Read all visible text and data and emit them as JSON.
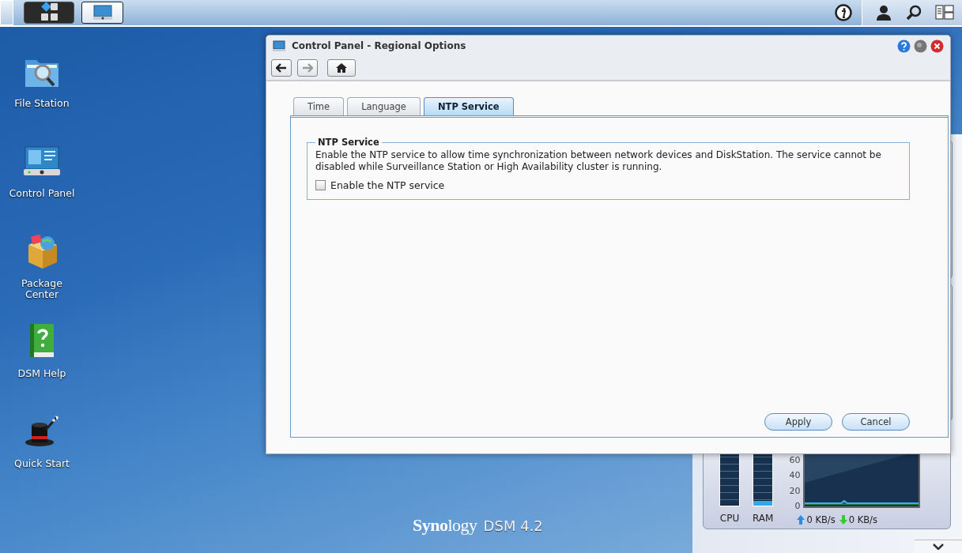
{
  "desktop_icons": [
    {
      "kind": "file-station",
      "label": "File Station"
    },
    {
      "kind": "control-panel",
      "label": "Control Panel"
    },
    {
      "kind": "package-center",
      "label": "Package Center"
    },
    {
      "kind": "help",
      "label": "DSM Help"
    },
    {
      "kind": "quick-start",
      "label": "Quick Start"
    }
  ],
  "window": {
    "title": "Control Panel - Regional Options",
    "tabs": [
      {
        "label": "Time",
        "selected": false
      },
      {
        "label": "Language",
        "selected": false
      },
      {
        "label": "NTP Service",
        "selected": true
      }
    ],
    "section": {
      "legend": "NTP Service",
      "description": "Enable the NTP service to allow time synchronization between network devices and DiskStation. The service cannot be disabled while Surveillance Station or High Availability cluster is running.",
      "checkbox": {
        "label": "Enable the NTP service",
        "checked": false
      }
    },
    "buttons": [
      "Apply",
      "Cancel"
    ]
  },
  "resource_monitor": {
    "meters": [
      {
        "label": "CPU",
        "level": 0
      },
      {
        "label": "RAM",
        "level": 0.08
      }
    ],
    "network": {
      "yticks": [
        "60",
        "40",
        "20",
        "0"
      ],
      "upload": "0 KB/s",
      "download": "0 KB/s"
    }
  },
  "logo": {
    "brand": "**Syno**logy",
    "product": "DSM 4.2"
  }
}
